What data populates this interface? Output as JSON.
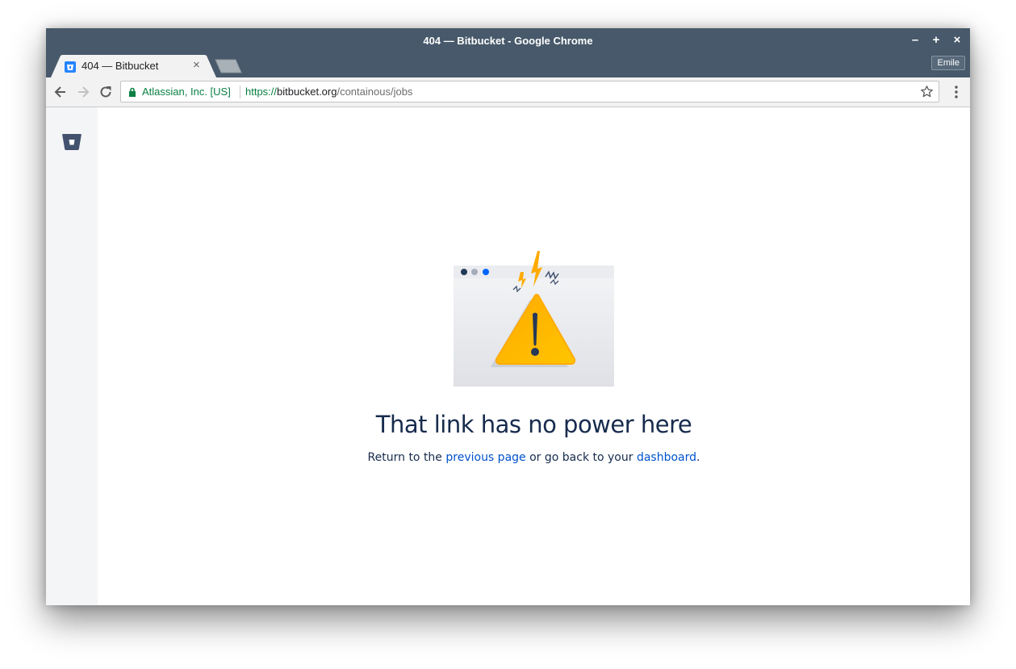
{
  "window": {
    "title": "404 — Bitbucket - Google Chrome",
    "controls": {
      "minimize": "–",
      "maximize": "+",
      "close": "×"
    },
    "profile": "Emile"
  },
  "tab": {
    "title": "404 — Bitbucket",
    "close": "×",
    "favicon": "bitbucket-icon"
  },
  "omnibox": {
    "security_label": "Atlassian, Inc. [US]",
    "url_scheme": "https://",
    "url_host": "bitbucket.org",
    "url_path": "/containous/jobs"
  },
  "page": {
    "heading": "That link has no power here",
    "message_prefix": "Return to the ",
    "previous_link": "previous page",
    "message_middle": " or go back to your ",
    "dashboard_link": "dashboard",
    "message_suffix": "."
  },
  "icons": {
    "back": "arrow-left-icon",
    "forward": "arrow-right-icon",
    "reload": "reload-icon",
    "lock": "lock-icon",
    "bookmark": "star-icon",
    "menu": "kebab-menu-icon",
    "logo": "bitbucket-logo-icon",
    "illustration": "warning-triangle-icon"
  },
  "colors": {
    "titlebar": "#47596a",
    "secure_green": "#0b8043",
    "link_blue": "#0052cc",
    "heading": "#172b4d",
    "warning_yellow": "#ffc400"
  }
}
